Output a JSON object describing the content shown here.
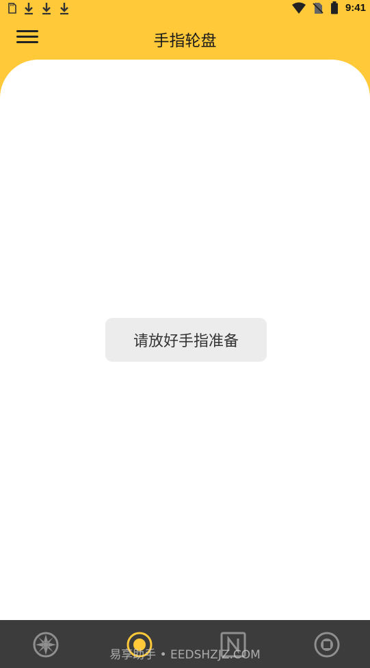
{
  "status_bar": {
    "time": "9:41",
    "left_icons": [
      "sd-card-icon",
      "download-icon",
      "download-icon",
      "download-icon"
    ],
    "right_icons": [
      "wifi-icon",
      "no-sim-icon",
      "battery-icon"
    ]
  },
  "header": {
    "title": "手指轮盘",
    "menu_icon": "hamburger-menu-icon",
    "background_color": "#ffc93a"
  },
  "main": {
    "prompt": "请放好手指准备"
  },
  "bottom_nav": {
    "items": [
      {
        "icon": "wheel-icon",
        "active": false
      },
      {
        "icon": "target-dot-icon",
        "active": true
      },
      {
        "icon": "n-box-icon",
        "active": false
      },
      {
        "icon": "circle-square-icon",
        "active": false
      }
    ],
    "active_color": "#ffc93a",
    "inactive_color": "#8f8f8f",
    "watermark": "易享助手 • EEDSHZJZ.COM"
  }
}
